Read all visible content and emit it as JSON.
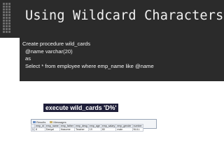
{
  "slide": {
    "title": "Using Wildcard Characters:",
    "code_lines": [
      "Create procedure wild_cards",
      "@name varchar(20)",
      "as",
      "Select * from employee where emp_name like @name"
    ],
    "exec_label": "execute wild_cards 'D%'"
  },
  "results": {
    "tabs": [
      "Results",
      "Messages"
    ],
    "columns": [
      "",
      "emp_id",
      "emp_name",
      "emp_father",
      "emp_desg",
      "emp_age",
      "emp_salary",
      "emp_gender",
      "number"
    ],
    "rows": [
      [
        "1",
        "8",
        "Danyal",
        "thasome",
        "Teacher",
        "19",
        "80",
        "male",
        "NULL"
      ]
    ]
  },
  "colors": {
    "dark_bg": "#2b2b2b",
    "text_light": "#f2f2f2",
    "label_bg": "#1f1f3a"
  }
}
